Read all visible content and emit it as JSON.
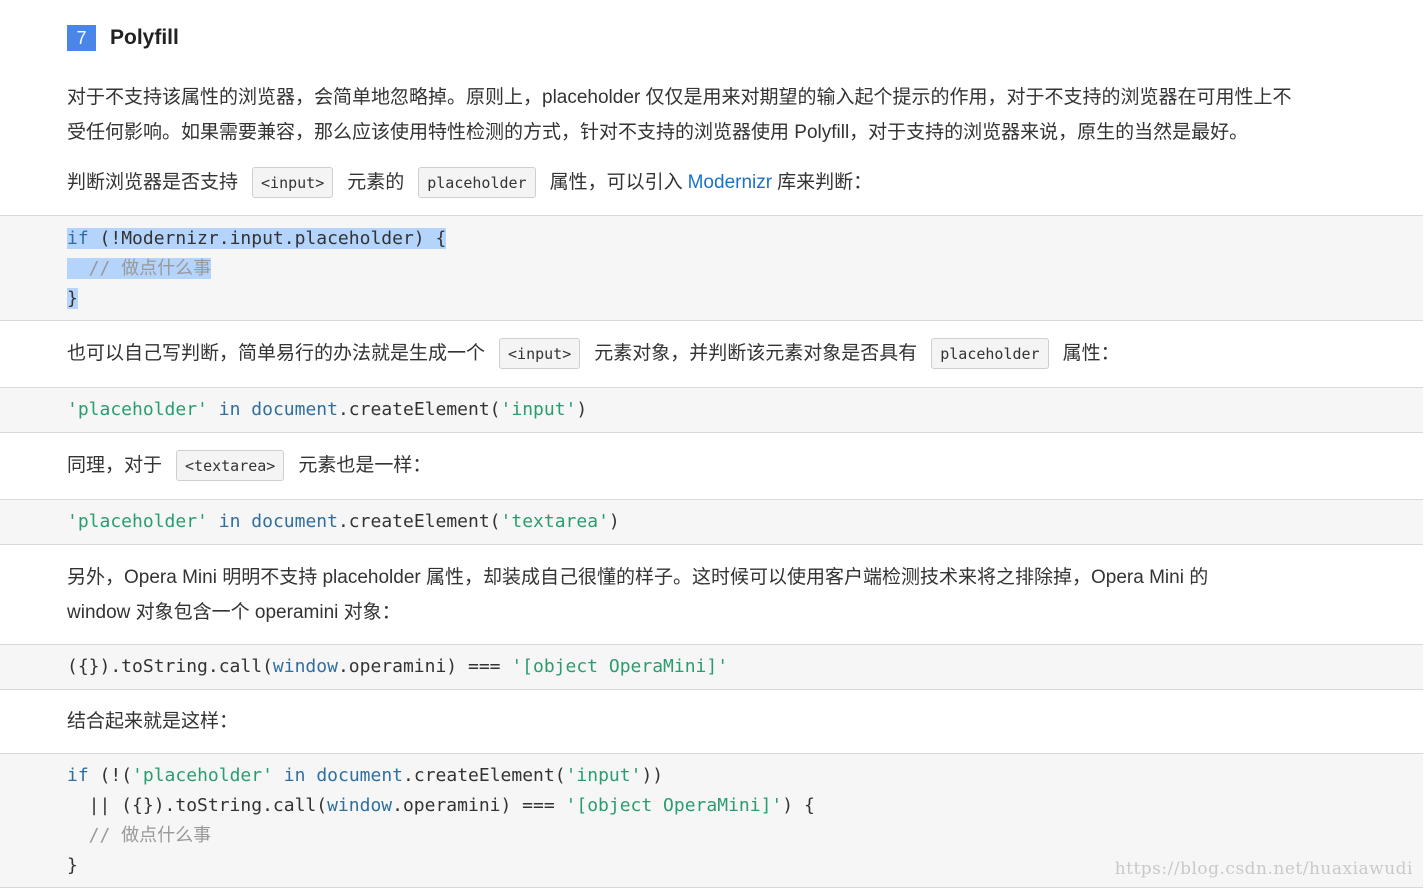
{
  "heading": {
    "number": "7",
    "title": "Polyfill"
  },
  "intro": {
    "line1": "对于不支持该属性的浏览器，会简单地忽略掉。原则上，placeholder 仅仅是用来对期望的输入起个提示的作用，对于不支持的浏览器在可用性上不",
    "line2": "受任何影响。如果需要兼容，那么应该使用特性检测的方式，针对不支持的浏览器使用 Polyfill，对于支持的浏览器来说，原生的当然是最好。"
  },
  "detect": {
    "prefix": "判断浏览器是否支持",
    "code1": "<input>",
    "mid": "元素的",
    "code2": "placeholder",
    "after": "属性，可以引入",
    "link": "Modernizr",
    "suffix": "库来判断："
  },
  "code1": {
    "l1_kw": "if",
    "l1_rest": " (!Modernizr.input.placeholder) {",
    "l2": "  // 做点什么事",
    "l3": "}"
  },
  "self": {
    "prefix": "也可以自己写判断，简单易行的办法就是生成一个",
    "code1": "<input>",
    "mid": "元素对象，并判断该元素对象是否具有",
    "code2": "placeholder",
    "suffix": "属性："
  },
  "code2": {
    "str1": "'placeholder'",
    "kw1": "in",
    "obj": "document",
    "call": ".createElement(",
    "str2": "'input'",
    "end": ")"
  },
  "textarea": {
    "prefix": "同理，对于",
    "code1": "<textarea>",
    "suffix": "元素也是一样："
  },
  "code3": {
    "str1": "'placeholder'",
    "kw1": "in",
    "obj": "document",
    "call": ".createElement(",
    "str2": "'textarea'",
    "end": ")"
  },
  "opera": {
    "line1": "另外，Opera Mini 明明不支持 placeholder 属性，却装成自己很懂的样子。这时候可以使用客户端检测技术来将之排除掉，Opera Mini 的",
    "line2": "window 对象包含一个 operamini 对象："
  },
  "code4": {
    "pre": "({}).toString.call(",
    "win": "window",
    "post": ".operamini) === ",
    "str": "'[object OperaMini]'"
  },
  "combine": {
    "text": "结合起来就是这样："
  },
  "code5": {
    "l1_kw": "if",
    "l1_a": " (!(",
    "l1_str1": "'placeholder'",
    "l1_in": "in",
    "l1_doc": "document",
    "l1_call": ".createElement(",
    "l1_str2": "'input'",
    "l1_end": "))",
    "l2_a": "  || ({}).toString.call(",
    "l2_win": "window",
    "l2_b": ".operamini) === ",
    "l2_str": "'[object OperaMini]'",
    "l2_end": ") {",
    "l3": "  // 做点什么事",
    "l4": "}"
  },
  "watermark": "https://blog.csdn.net/huaxiawudi"
}
